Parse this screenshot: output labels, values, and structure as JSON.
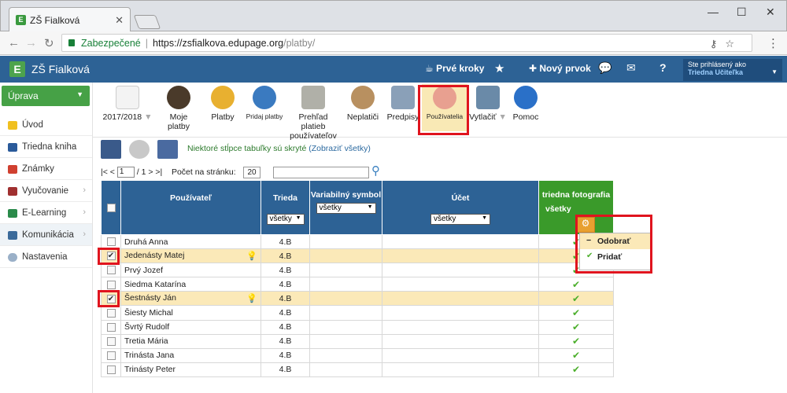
{
  "browser": {
    "tab_title": "ZŠ Fialková",
    "secure_label": "Zabezpečené",
    "url_host": "https://zsfialkova.edupage.org",
    "url_path": "/platby/"
  },
  "app": {
    "title": "ZŠ Fialková",
    "top": {
      "first_steps": "Prvé kroky",
      "new_item": "Nový prvok",
      "help": "?",
      "logged_label": "Ste prihlásený ako",
      "logged_user": "Triedna Učiteľka"
    }
  },
  "sidebar": {
    "uprava": "Úprava",
    "items": [
      {
        "label": "Úvod"
      },
      {
        "label": "Triedna kniha"
      },
      {
        "label": "Známky"
      },
      {
        "label": "Vyučovanie"
      },
      {
        "label": "E-Learning"
      },
      {
        "label": "Komunikácia"
      },
      {
        "label": "Nastavenia"
      }
    ]
  },
  "toolbar": {
    "year": "2017/2018",
    "items": [
      "Moje platby",
      "Platby",
      "Pridaj platby",
      "Prehľad platieb používateľov",
      "Neplatiči",
      "Predpisy",
      "Používatelia",
      "Vytlačiť",
      "Pomoc"
    ]
  },
  "hidden_info": {
    "text": "Niektoré stĺpce tabuľky sú skryté",
    "link": "(Zobraziť všetky)"
  },
  "pager": {
    "nav": "|< <",
    "page": "1",
    "total": "/ 1 > >|",
    "per_page_label": "Počet na stránku:",
    "per_page": "20"
  },
  "table": {
    "headers": {
      "user": "Používateľ",
      "class": "Trieda",
      "varsym": "Variabilný symbol",
      "account": "Účet",
      "photo": "triedna fotografia"
    },
    "filter": "všetky",
    "rows": [
      {
        "name": "Druhá Anna",
        "cls": "4.B"
      },
      {
        "name": "Jedenásty Matej",
        "cls": "4.B"
      },
      {
        "name": "Prvý Jozef",
        "cls": "4.B"
      },
      {
        "name": "Siedma Katarína",
        "cls": "4.B"
      },
      {
        "name": "Šestnásty Ján",
        "cls": "4.B"
      },
      {
        "name": "Šiesty Michal",
        "cls": "4.B"
      },
      {
        "name": "Švrtý Rudolf",
        "cls": "4.B"
      },
      {
        "name": "Tretia Mária",
        "cls": "4.B"
      },
      {
        "name": "Trinásta Jana",
        "cls": "4.B"
      },
      {
        "name": "Trinásty Peter",
        "cls": "4.B"
      }
    ]
  },
  "popup": {
    "remove": "Odobrať",
    "add": "Pridať"
  }
}
